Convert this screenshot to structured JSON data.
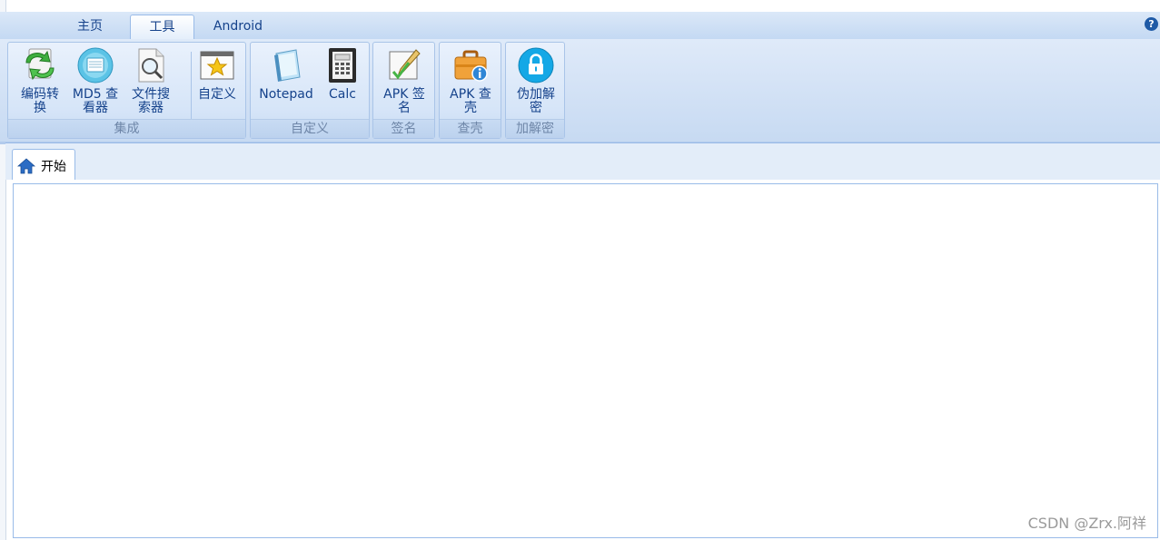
{
  "tabs": [
    {
      "label": "主页",
      "active": false
    },
    {
      "label": "工具",
      "active": true
    },
    {
      "label": "Android",
      "active": false
    }
  ],
  "help_icon": "question-icon",
  "ribbon": {
    "groups": [
      {
        "label": "集成",
        "buttons": [
          {
            "label": "编码转\n换",
            "icon": "convert-arrows-icon"
          },
          {
            "label": "MD5 查\n看器",
            "icon": "md5-disc-icon"
          },
          {
            "label": "文件搜\n索器",
            "icon": "file-search-icon"
          },
          {
            "label": "自定义",
            "icon": "star-window-icon"
          }
        ]
      },
      {
        "label": "自定义",
        "buttons": [
          {
            "label": "Notepad",
            "icon": "notepad-icon"
          },
          {
            "label": "Calc",
            "icon": "calculator-icon"
          }
        ]
      },
      {
        "label": "签名",
        "buttons": [
          {
            "label": "APK 签\n名",
            "icon": "sign-pen-icon"
          }
        ]
      },
      {
        "label": "查壳",
        "buttons": [
          {
            "label": "APK 查\n壳",
            "icon": "briefcase-info-icon"
          }
        ]
      },
      {
        "label": "加解密",
        "buttons": [
          {
            "label": "伪加解\n密",
            "icon": "lock-icon"
          }
        ]
      }
    ]
  },
  "doc_tab": {
    "label": "开始",
    "icon": "home-icon"
  },
  "watermark": "CSDN @Zrx.阿祥",
  "colors": {
    "accent": "#15428b",
    "ribbon_bg": "#d6e5f8",
    "border": "#99bbe8"
  }
}
